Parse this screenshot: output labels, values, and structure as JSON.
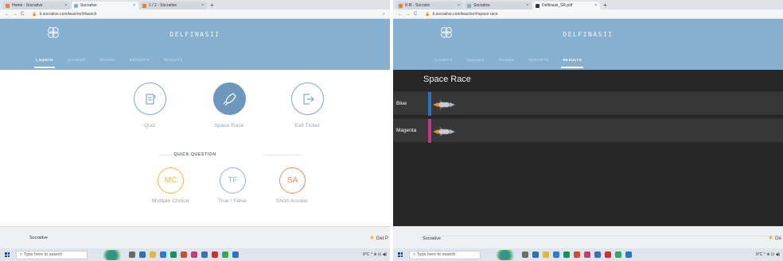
{
  "left": {
    "tabs": [
      {
        "label": "Home - Socrative",
        "favicon_color": "#f07b2a",
        "active": false
      },
      {
        "label": "Socrative",
        "favicon_color": "#86afd0",
        "active": true
      },
      {
        "label": "1 / 2 - Socrative",
        "favicon_color": "#f07b2a",
        "active": false
      }
    ],
    "url": "b.socrative.com/teacher/#launch",
    "room": "DELFINASII",
    "nav": [
      "LAUNCH",
      "QUIZZES",
      "ROOMS",
      "REPORTS",
      "RESULTS"
    ],
    "nav_active": 0,
    "activities": [
      "Quiz",
      "Space Race",
      "Exit Ticket"
    ],
    "quick_question": "QUICK QUESTION",
    "quick": [
      {
        "abbr": "MC",
        "label": "Multiple Choice",
        "color": "#f2b640"
      },
      {
        "abbr": "TF",
        "label": "True / False",
        "color": "#8fb3d4"
      },
      {
        "abbr": "SA",
        "label": "Short Answer",
        "color": "#ef8a5e"
      }
    ],
    "footer_brand": "Socrative",
    "footer_getpro": "Get P",
    "search_placeholder": "Type here to search",
    "tray": "9°C  ^ ⊕ ⊡ ◀)"
  },
  "right": {
    "tabs": [
      {
        "label": "8-III - Socrativ",
        "favicon_color": "#f07b2a",
        "active": false
      },
      {
        "label": "Socrative",
        "favicon_color": "#86afd0",
        "active": false
      },
      {
        "label": "Delfinasii_SR.pdf",
        "favicon_color": "#333333",
        "active": true
      }
    ],
    "url": "b.socrative.com/teacher/#space-race",
    "room": "DELFINASII",
    "nav": [
      "LAUNCH",
      "QUIZZES",
      "ROOMS",
      "REPORTS",
      "RESULTS"
    ],
    "nav_active": 4,
    "race_title": "Space Race",
    "teams": [
      {
        "name": "Blue",
        "color": "#2f6fc0"
      },
      {
        "name": "Magenta",
        "color": "#c2388a"
      }
    ],
    "footer_brand": "Socrative",
    "footer_getpro": "Ge",
    "search_placeholder": "Type here to search",
    "tray": "9°C  ^ ⊕ ⊡ ◀)"
  },
  "taskbar_apps": [
    "#6b6b6b",
    "#2f6fb8",
    "#e8b43c",
    "#2b7bd6",
    "#1a8f5e",
    "#d14b2f",
    "#c43b75",
    "#3a6fc0",
    "#d12f2f",
    "#3aa65a",
    "#2f73c8",
    "#3a8a3a"
  ]
}
